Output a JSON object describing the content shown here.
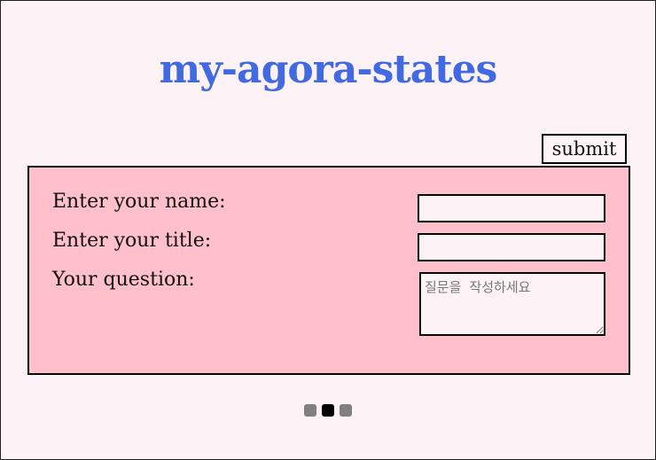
{
  "header": {
    "title": "my-agora-states"
  },
  "form": {
    "submit_label": "submit",
    "name_label": "Enter your name:",
    "title_label": "Enter your title:",
    "question_label": "Your question:",
    "name_value": "",
    "title_value": "",
    "question_placeholder": "질문을 작성하세요"
  },
  "pagination": {
    "count": 3,
    "active_index": 1
  }
}
